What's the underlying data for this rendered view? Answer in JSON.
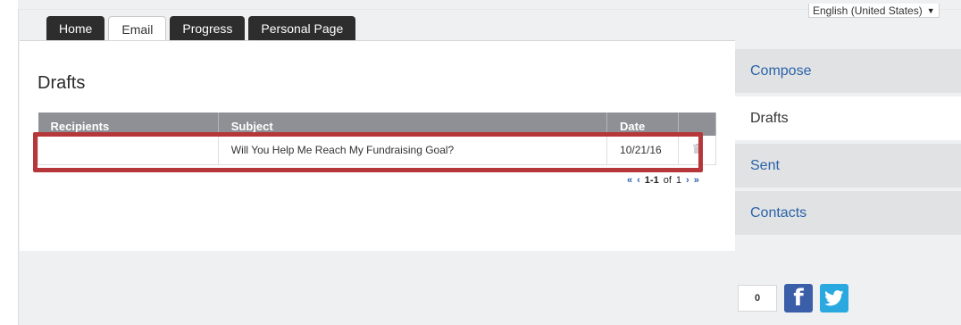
{
  "tabs": [
    {
      "label": "Home"
    },
    {
      "label": "Email"
    },
    {
      "label": "Progress"
    },
    {
      "label": "Personal Page"
    }
  ],
  "language": {
    "selected": "English (United States)"
  },
  "page": {
    "title": "Drafts"
  },
  "table": {
    "headers": [
      "Recipients",
      "Subject",
      "Date",
      ""
    ],
    "rows": [
      {
        "recipients": "",
        "subject": "Will You Help Me Reach My Fundraising Goal?",
        "date": "10/21/16",
        "action_icon": "trash-icon"
      }
    ]
  },
  "pager": {
    "first": "«",
    "prev": "‹",
    "range": "1-1",
    "of_label": "of",
    "total": "1",
    "next": "›",
    "last": "»"
  },
  "sidebar": {
    "items": [
      {
        "label": "Compose"
      },
      {
        "label": "Drafts"
      },
      {
        "label": "Sent"
      },
      {
        "label": "Contacts"
      }
    ]
  },
  "social": {
    "share_count": "0",
    "facebook_icon": "facebook-icon",
    "twitter_icon": "twitter-icon"
  },
  "colors": {
    "highlight": "#b5373a",
    "tab_dark": "#2d2d2d",
    "link": "#2a63a8",
    "header_gray": "#8e9096"
  }
}
